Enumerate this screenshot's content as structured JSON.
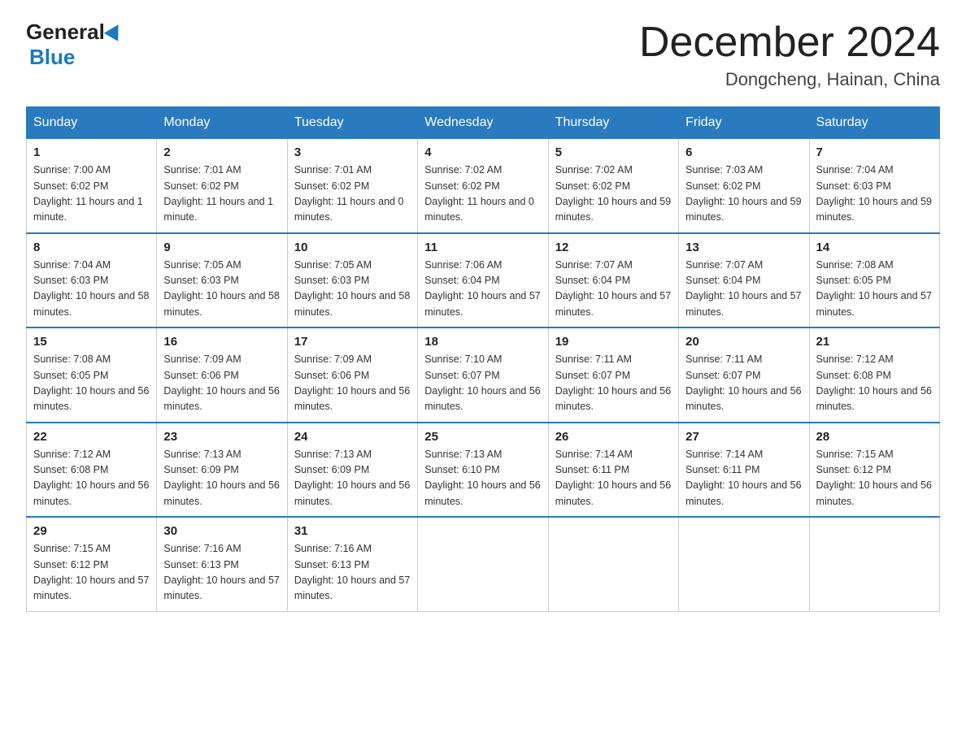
{
  "logo": {
    "general": "General",
    "blue": "Blue"
  },
  "title": "December 2024",
  "location": "Dongcheng, Hainan, China",
  "days_of_week": [
    "Sunday",
    "Monday",
    "Tuesday",
    "Wednesday",
    "Thursday",
    "Friday",
    "Saturday"
  ],
  "weeks": [
    [
      {
        "day": "1",
        "sunrise": "7:00 AM",
        "sunset": "6:02 PM",
        "daylight": "11 hours and 1 minute."
      },
      {
        "day": "2",
        "sunrise": "7:01 AM",
        "sunset": "6:02 PM",
        "daylight": "11 hours and 1 minute."
      },
      {
        "day": "3",
        "sunrise": "7:01 AM",
        "sunset": "6:02 PM",
        "daylight": "11 hours and 0 minutes."
      },
      {
        "day": "4",
        "sunrise": "7:02 AM",
        "sunset": "6:02 PM",
        "daylight": "11 hours and 0 minutes."
      },
      {
        "day": "5",
        "sunrise": "7:02 AM",
        "sunset": "6:02 PM",
        "daylight": "10 hours and 59 minutes."
      },
      {
        "day": "6",
        "sunrise": "7:03 AM",
        "sunset": "6:02 PM",
        "daylight": "10 hours and 59 minutes."
      },
      {
        "day": "7",
        "sunrise": "7:04 AM",
        "sunset": "6:03 PM",
        "daylight": "10 hours and 59 minutes."
      }
    ],
    [
      {
        "day": "8",
        "sunrise": "7:04 AM",
        "sunset": "6:03 PM",
        "daylight": "10 hours and 58 minutes."
      },
      {
        "day": "9",
        "sunrise": "7:05 AM",
        "sunset": "6:03 PM",
        "daylight": "10 hours and 58 minutes."
      },
      {
        "day": "10",
        "sunrise": "7:05 AM",
        "sunset": "6:03 PM",
        "daylight": "10 hours and 58 minutes."
      },
      {
        "day": "11",
        "sunrise": "7:06 AM",
        "sunset": "6:04 PM",
        "daylight": "10 hours and 57 minutes."
      },
      {
        "day": "12",
        "sunrise": "7:07 AM",
        "sunset": "6:04 PM",
        "daylight": "10 hours and 57 minutes."
      },
      {
        "day": "13",
        "sunrise": "7:07 AM",
        "sunset": "6:04 PM",
        "daylight": "10 hours and 57 minutes."
      },
      {
        "day": "14",
        "sunrise": "7:08 AM",
        "sunset": "6:05 PM",
        "daylight": "10 hours and 57 minutes."
      }
    ],
    [
      {
        "day": "15",
        "sunrise": "7:08 AM",
        "sunset": "6:05 PM",
        "daylight": "10 hours and 56 minutes."
      },
      {
        "day": "16",
        "sunrise": "7:09 AM",
        "sunset": "6:06 PM",
        "daylight": "10 hours and 56 minutes."
      },
      {
        "day": "17",
        "sunrise": "7:09 AM",
        "sunset": "6:06 PM",
        "daylight": "10 hours and 56 minutes."
      },
      {
        "day": "18",
        "sunrise": "7:10 AM",
        "sunset": "6:07 PM",
        "daylight": "10 hours and 56 minutes."
      },
      {
        "day": "19",
        "sunrise": "7:11 AM",
        "sunset": "6:07 PM",
        "daylight": "10 hours and 56 minutes."
      },
      {
        "day": "20",
        "sunrise": "7:11 AM",
        "sunset": "6:07 PM",
        "daylight": "10 hours and 56 minutes."
      },
      {
        "day": "21",
        "sunrise": "7:12 AM",
        "sunset": "6:08 PM",
        "daylight": "10 hours and 56 minutes."
      }
    ],
    [
      {
        "day": "22",
        "sunrise": "7:12 AM",
        "sunset": "6:08 PM",
        "daylight": "10 hours and 56 minutes."
      },
      {
        "day": "23",
        "sunrise": "7:13 AM",
        "sunset": "6:09 PM",
        "daylight": "10 hours and 56 minutes."
      },
      {
        "day": "24",
        "sunrise": "7:13 AM",
        "sunset": "6:09 PM",
        "daylight": "10 hours and 56 minutes."
      },
      {
        "day": "25",
        "sunrise": "7:13 AM",
        "sunset": "6:10 PM",
        "daylight": "10 hours and 56 minutes."
      },
      {
        "day": "26",
        "sunrise": "7:14 AM",
        "sunset": "6:11 PM",
        "daylight": "10 hours and 56 minutes."
      },
      {
        "day": "27",
        "sunrise": "7:14 AM",
        "sunset": "6:11 PM",
        "daylight": "10 hours and 56 minutes."
      },
      {
        "day": "28",
        "sunrise": "7:15 AM",
        "sunset": "6:12 PM",
        "daylight": "10 hours and 56 minutes."
      }
    ],
    [
      {
        "day": "29",
        "sunrise": "7:15 AM",
        "sunset": "6:12 PM",
        "daylight": "10 hours and 57 minutes."
      },
      {
        "day": "30",
        "sunrise": "7:16 AM",
        "sunset": "6:13 PM",
        "daylight": "10 hours and 57 minutes."
      },
      {
        "day": "31",
        "sunrise": "7:16 AM",
        "sunset": "6:13 PM",
        "daylight": "10 hours and 57 minutes."
      },
      null,
      null,
      null,
      null
    ]
  ],
  "labels": {
    "sunrise": "Sunrise:",
    "sunset": "Sunset:",
    "daylight": "Daylight:"
  }
}
